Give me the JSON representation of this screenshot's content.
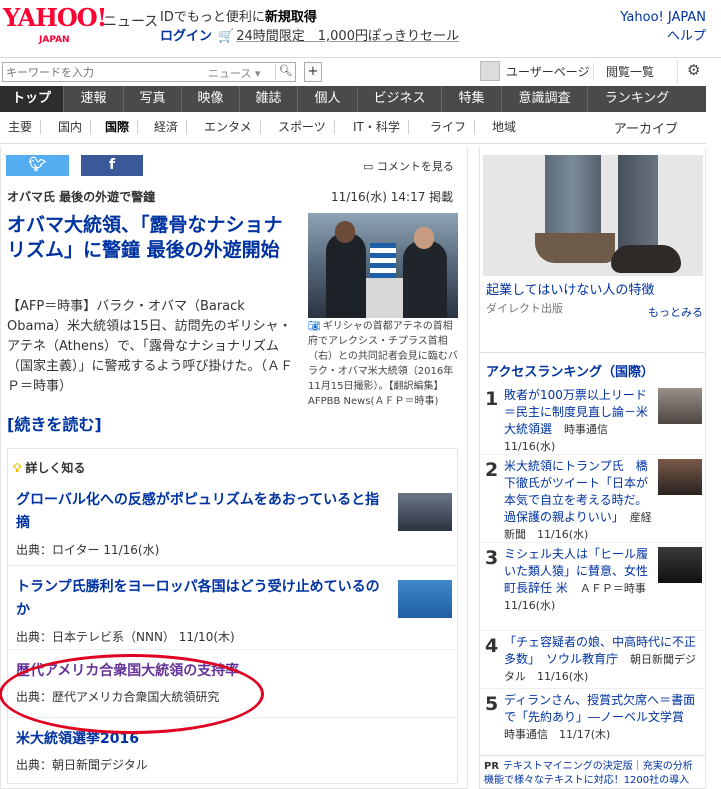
{
  "header": {
    "logo_text": "YAHOO!",
    "logo_sub": "JAPAN",
    "section": "ニュース",
    "promo_prefix": "IDでもっと便利に",
    "promo_link": "新規取得",
    "login": "ログイン",
    "sale_text": "24時間限定　1,000円ぽっきりセール",
    "yahoo_japan": "Yahoo! JAPAN",
    "help": "ヘルプ"
  },
  "search": {
    "placeholder": "キーワードを入力",
    "category": "ニュース",
    "plus": "+",
    "user_page": "ユーザーページ",
    "history": "閲覧一覧"
  },
  "nav": [
    "トップ",
    "速報",
    "写真",
    "映像",
    "雑誌",
    "個人",
    "ビジネス",
    "特集",
    "意識調査",
    "ランキング"
  ],
  "subnav": [
    "主要",
    "国内",
    "国際",
    "経済",
    "エンタメ",
    "スポーツ",
    "IT・科学",
    "ライフ",
    "地域"
  ],
  "archive": "アーカイブ",
  "article": {
    "comment": "コメントを見る",
    "kicker": "オバマ氏 最後の外遊で警鐘",
    "datetime": "11/16(水) 14:17 掲載",
    "headline": "オバマ大統領、「露骨なナショナリズム」に警鐘 最後の外遊開始",
    "caption": "ギリシャの首都アテネの首相府でアレクシス・チプラス首相（右）との共同記者会見に臨むバラク・オバマ米大統領（2016年11月15日撮影）。【翻訳編集】 AFPBB News(ＡＦＰ＝時事)",
    "body": "【AFP＝時事】バラク・オバマ（Barack Obama）米大統領は15日、訪問先のギリシャ・アテネ（Athens）で、「露骨なナショナリズム（国家主義）」に警戒するよう呼び掛けた。（ＡＦＰ＝時事）",
    "more": "[続きを読む]"
  },
  "related": {
    "heading": "詳しく知る",
    "items": [
      {
        "title": "グローバル化への反感がポピュリズムをあおっていると指摘",
        "source": "出典：ロイター 11/16(水)"
      },
      {
        "title": "トランプ氏勝利をヨーロッパ各国はどう受け止めているのか",
        "source": "出典：日本テレビ系（NNN） 11/10(木)"
      },
      {
        "title": "歴代アメリカ合衆国大統領の支持率",
        "source": "出典：歴代アメリカ合衆国大統領研究"
      },
      {
        "title": "米大統領選挙2016",
        "source": "出典：朝日新聞デジタル"
      }
    ]
  },
  "sidebar": {
    "ad_title": "起業してはいけない人の特徴",
    "ad_source": "ダイレクト出版",
    "ad_more": "もっとみる",
    "rank_title": "アクセスランキング（国際）",
    "ranking": [
      {
        "n": "1",
        "title": "敗者が100万票以上リード＝民主に制度見直し論－米大統領選",
        "src": "時事通信　11/16(水)"
      },
      {
        "n": "2",
        "title": "米大統領にトランプ氏　橋下徹氏がツイート「日本が本気で自立を考える時だ。過保護の親よりいい」",
        "src": "産経新聞　11/16(水)"
      },
      {
        "n": "3",
        "title": "ミシェル夫人は「ヒール履いた類人猿」に賛意、女性町長辞任 米",
        "src": "ＡＦＰ＝時事　11/16(水)"
      },
      {
        "n": "4",
        "title": "「チェ容疑者の娘、中高時代に不正多数」　ソウル教育庁",
        "src": "朝日新聞デジタル　11/16(水)"
      },
      {
        "n": "5",
        "title": "ディランさん、授賞式欠席へ＝書面で「先約あり」―ノーベル文学賞",
        "src": "時事通信　11/17(木)"
      }
    ],
    "pr_tag": "PR",
    "pr_text": "テキストマイニングの決定版｜充実の分析機能で様々なテキストに対応！1200社の導入"
  }
}
